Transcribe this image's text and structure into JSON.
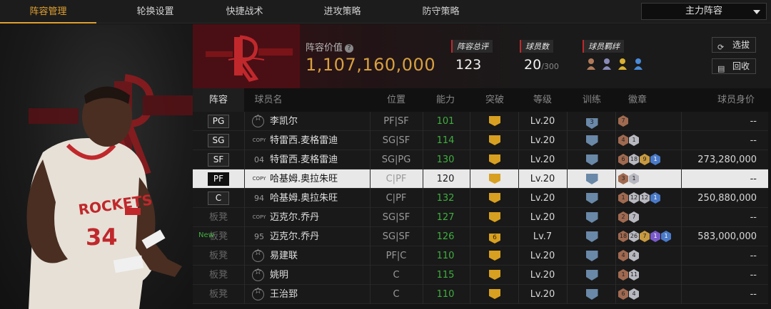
{
  "nav": {
    "tabs": [
      "阵容管理",
      "轮换设置",
      "快捷战术",
      "进攻策略",
      "防守策略"
    ],
    "active_index": 0,
    "roster_select": "主力阵容"
  },
  "team": {
    "value_label": "阵容价值",
    "value": "1,107,160,000",
    "rating_label": "阵容总评",
    "rating": "123",
    "players_label": "球员数",
    "players": "20",
    "players_max": "/300",
    "bond_label": "球员羁绊",
    "select_button": "选拔",
    "recycle_button": "回收"
  },
  "table": {
    "headers": [
      "阵容",
      "球员名",
      "位置",
      "能力",
      "突破",
      "等级",
      "训练",
      "徽章",
      "球员身价"
    ],
    "rows": [
      {
        "slot": "PG",
        "prefix": "star",
        "name": "李凯尔",
        "pos": "PF|SF",
        "ability": "101",
        "breakthrough": "",
        "level": "Lv.20",
        "training": "3",
        "badges": [
          {
            "c": "bronze",
            "t": "7"
          }
        ],
        "value": "--"
      },
      {
        "slot": "SG",
        "prefix": "COPY",
        "name": "特雷西.麦格雷迪",
        "pos": "SG|SF",
        "ability": "114",
        "breakthrough": "",
        "level": "Lv.20",
        "training": "",
        "badges": [
          {
            "c": "bronze",
            "t": "4"
          },
          {
            "c": "silver",
            "t": "1"
          }
        ],
        "value": "--"
      },
      {
        "slot": "SF",
        "prefix": "04",
        "name": "特雷西.麦格雷迪",
        "pos": "SG|PG",
        "ability": "130",
        "breakthrough": "",
        "level": "Lv.20",
        "training": "",
        "badges": [
          {
            "c": "bronze",
            "t": "6"
          },
          {
            "c": "silver",
            "t": "18"
          },
          {
            "c": "gold",
            "t": "9"
          },
          {
            "c": "blue",
            "t": "1"
          }
        ],
        "value": "273,280,000"
      },
      {
        "slot": "PF",
        "prefix": "COPY",
        "name": "哈基姆.奥拉朱旺",
        "pos": "C|PF",
        "ability": "120",
        "breakthrough": "",
        "level": "Lv.20",
        "training": "",
        "badges": [
          {
            "c": "bronze",
            "t": "3"
          },
          {
            "c": "silver",
            "t": "1"
          }
        ],
        "value": "--",
        "selected": true
      },
      {
        "slot": "C",
        "prefix": "94",
        "name": "哈基姆.奥拉朱旺",
        "pos": "C|PF",
        "ability": "132",
        "breakthrough": "",
        "level": "Lv.20",
        "training": "",
        "badges": [
          {
            "c": "bronze",
            "t": "1"
          },
          {
            "c": "silver",
            "t": "12"
          },
          {
            "c": "silver",
            "t": "12"
          },
          {
            "c": "blue",
            "t": "1"
          }
        ],
        "value": "250,880,000"
      },
      {
        "slot": "板凳",
        "prefix": "COPY",
        "name": "迈克尔.乔丹",
        "pos": "SG|SF",
        "ability": "127",
        "breakthrough": "",
        "level": "Lv.20",
        "training": "",
        "badges": [
          {
            "c": "bronze",
            "t": "2"
          },
          {
            "c": "silver",
            "t": "7"
          }
        ],
        "value": "--"
      },
      {
        "slot": "板凳",
        "prefix": "95",
        "name": "迈克尔.乔丹",
        "pos": "SG|SF",
        "ability": "126",
        "breakthrough": "6",
        "level": "Lv.7",
        "training": "",
        "badges": [
          {
            "c": "bronze",
            "t": "18"
          },
          {
            "c": "silver",
            "t": "26"
          },
          {
            "c": "gold",
            "t": "7"
          },
          {
            "c": "purple",
            "t": "1"
          },
          {
            "c": "blue",
            "t": "1"
          }
        ],
        "value": "583,000,000",
        "new": "New"
      },
      {
        "slot": "板凳",
        "prefix": "star",
        "name": "易建联",
        "pos": "PF|C",
        "ability": "110",
        "breakthrough": "",
        "level": "Lv.20",
        "training": "",
        "badges": [
          {
            "c": "bronze",
            "t": "4"
          },
          {
            "c": "silver",
            "t": "4"
          }
        ],
        "value": "--"
      },
      {
        "slot": "板凳",
        "prefix": "star",
        "name": "姚明",
        "pos": "C",
        "ability": "115",
        "breakthrough": "",
        "level": "Lv.20",
        "training": "",
        "badges": [
          {
            "c": "bronze",
            "t": "1"
          },
          {
            "c": "silver",
            "t": "11"
          }
        ],
        "value": "--"
      },
      {
        "slot": "板凳",
        "prefix": "star",
        "name": "王治郅",
        "pos": "C",
        "ability": "110",
        "breakthrough": "",
        "level": "Lv.20",
        "training": "",
        "badges": [
          {
            "c": "bronze",
            "t": "6"
          },
          {
            "c": "silver",
            "t": "4"
          }
        ],
        "value": "--"
      }
    ]
  },
  "colors": {
    "accent": "#e0a030",
    "ability_green": "#3fae3f",
    "team_red": "#c0282c"
  }
}
